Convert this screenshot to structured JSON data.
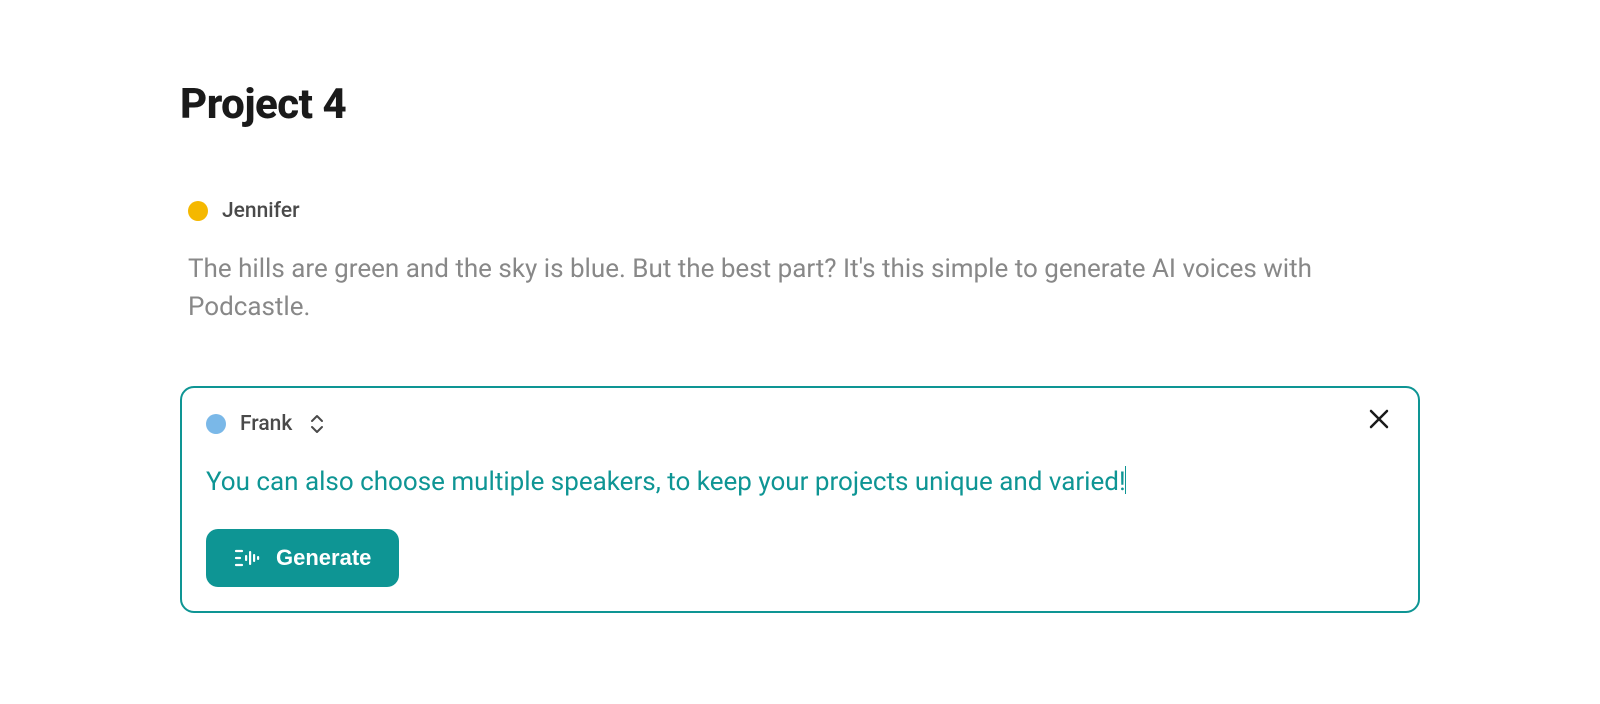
{
  "page": {
    "title": "Project 4"
  },
  "blocks": [
    {
      "speaker": "Jennifer",
      "color": "#F5B800",
      "text": "The hills are green and the sky is blue. But the best part? It's this simple to generate AI voices with Podcastle."
    }
  ],
  "editor": {
    "speaker": "Frank",
    "color": "#7AB8E8",
    "text": "You can also choose multiple speakers, to keep your projects unique and varied!",
    "generate_label": "Generate"
  }
}
